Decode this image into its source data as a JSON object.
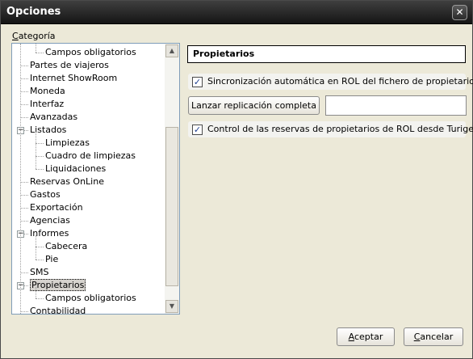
{
  "window": {
    "title": "Opciones",
    "close_glyph": "✕"
  },
  "category": {
    "label_prefix": "",
    "label_acc": "C",
    "label_rest": "ategoría"
  },
  "tree": {
    "items": [
      {
        "label": "Campos obligatorios",
        "level": 1,
        "selected": false
      },
      {
        "label": "Partes de viajeros",
        "level": 0,
        "selected": false
      },
      {
        "label": "Internet ShowRoom",
        "level": 0,
        "selected": false
      },
      {
        "label": "Moneda",
        "level": 0,
        "selected": false
      },
      {
        "label": "Interfaz",
        "level": 0,
        "selected": false
      },
      {
        "label": "Avanzadas",
        "level": 0,
        "selected": false
      },
      {
        "label": "Listados",
        "level": 0,
        "selected": false,
        "expander": "−"
      },
      {
        "label": "Limpiezas",
        "level": 1,
        "selected": false
      },
      {
        "label": "Cuadro de limpiezas",
        "level": 1,
        "selected": false
      },
      {
        "label": "Liquidaciones",
        "level": 1,
        "selected": false
      },
      {
        "label": "Reservas OnLine",
        "level": 0,
        "selected": false
      },
      {
        "label": "Gastos",
        "level": 0,
        "selected": false
      },
      {
        "label": "Exportación",
        "level": 0,
        "selected": false
      },
      {
        "label": "Agencias",
        "level": 0,
        "selected": false
      },
      {
        "label": "Informes",
        "level": 0,
        "selected": false,
        "expander": "−"
      },
      {
        "label": "Cabecera",
        "level": 1,
        "selected": false
      },
      {
        "label": "Pie",
        "level": 1,
        "selected": false
      },
      {
        "label": "SMS",
        "level": 0,
        "selected": false
      },
      {
        "label": "Propietarios",
        "level": 0,
        "selected": true,
        "expander": "−"
      },
      {
        "label": "Campos obligatorios",
        "level": 1,
        "selected": false
      },
      {
        "label": "Contabilidad",
        "level": 0,
        "selected": false
      }
    ],
    "scroll_up": "▲",
    "scroll_down": "▼"
  },
  "panel": {
    "section_title": "Propietarios",
    "sync_check": {
      "checked": true,
      "glyph": "✓",
      "label": "Sincronización automática en ROL del fichero de propietarios"
    },
    "replication_button": "Lanzar replicación completa",
    "replication_value": "",
    "control_check": {
      "checked": true,
      "glyph": "✓",
      "label": "Control de las reservas de propietarios de ROL desde Turigest"
    }
  },
  "footer": {
    "accept": {
      "acc": "A",
      "rest": "ceptar"
    },
    "cancel": {
      "acc": "C",
      "rest": "ancelar"
    }
  }
}
